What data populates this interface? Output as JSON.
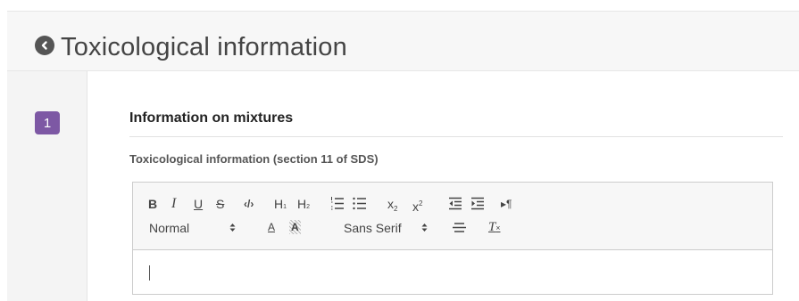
{
  "header": {
    "title": "Toxicological information"
  },
  "step": {
    "number": "1"
  },
  "section": {
    "title": "Information on mixtures"
  },
  "field": {
    "label": "Toxicological information (section 11 of SDS)"
  },
  "toolbar": {
    "bold": "B",
    "italic": "I",
    "underline": "U",
    "strike": "S",
    "code": "‹/›",
    "h1": "H",
    "h1_sub": "1",
    "h2": "H",
    "h2_sub": "2",
    "ordered_list_icon": "ordered-list-icon",
    "bullet_list_icon": "bullet-list-icon",
    "subscript": "x",
    "subscript_mark": "2",
    "superscript": "x",
    "superscript_mark": "2",
    "outdent_icon": "outdent-icon",
    "indent_icon": "indent-icon",
    "direction": "▸¶",
    "header_select": "Normal",
    "font_color": "A",
    "background_color": "A",
    "font_select": "Sans Serif",
    "align_icon": "align-icon",
    "clean": "T"
  },
  "editor": {
    "content": ""
  },
  "colors": {
    "step_badge": "#7d58a4",
    "header_bg": "#f7f7f7",
    "rail_bg": "#f4f4f4"
  }
}
